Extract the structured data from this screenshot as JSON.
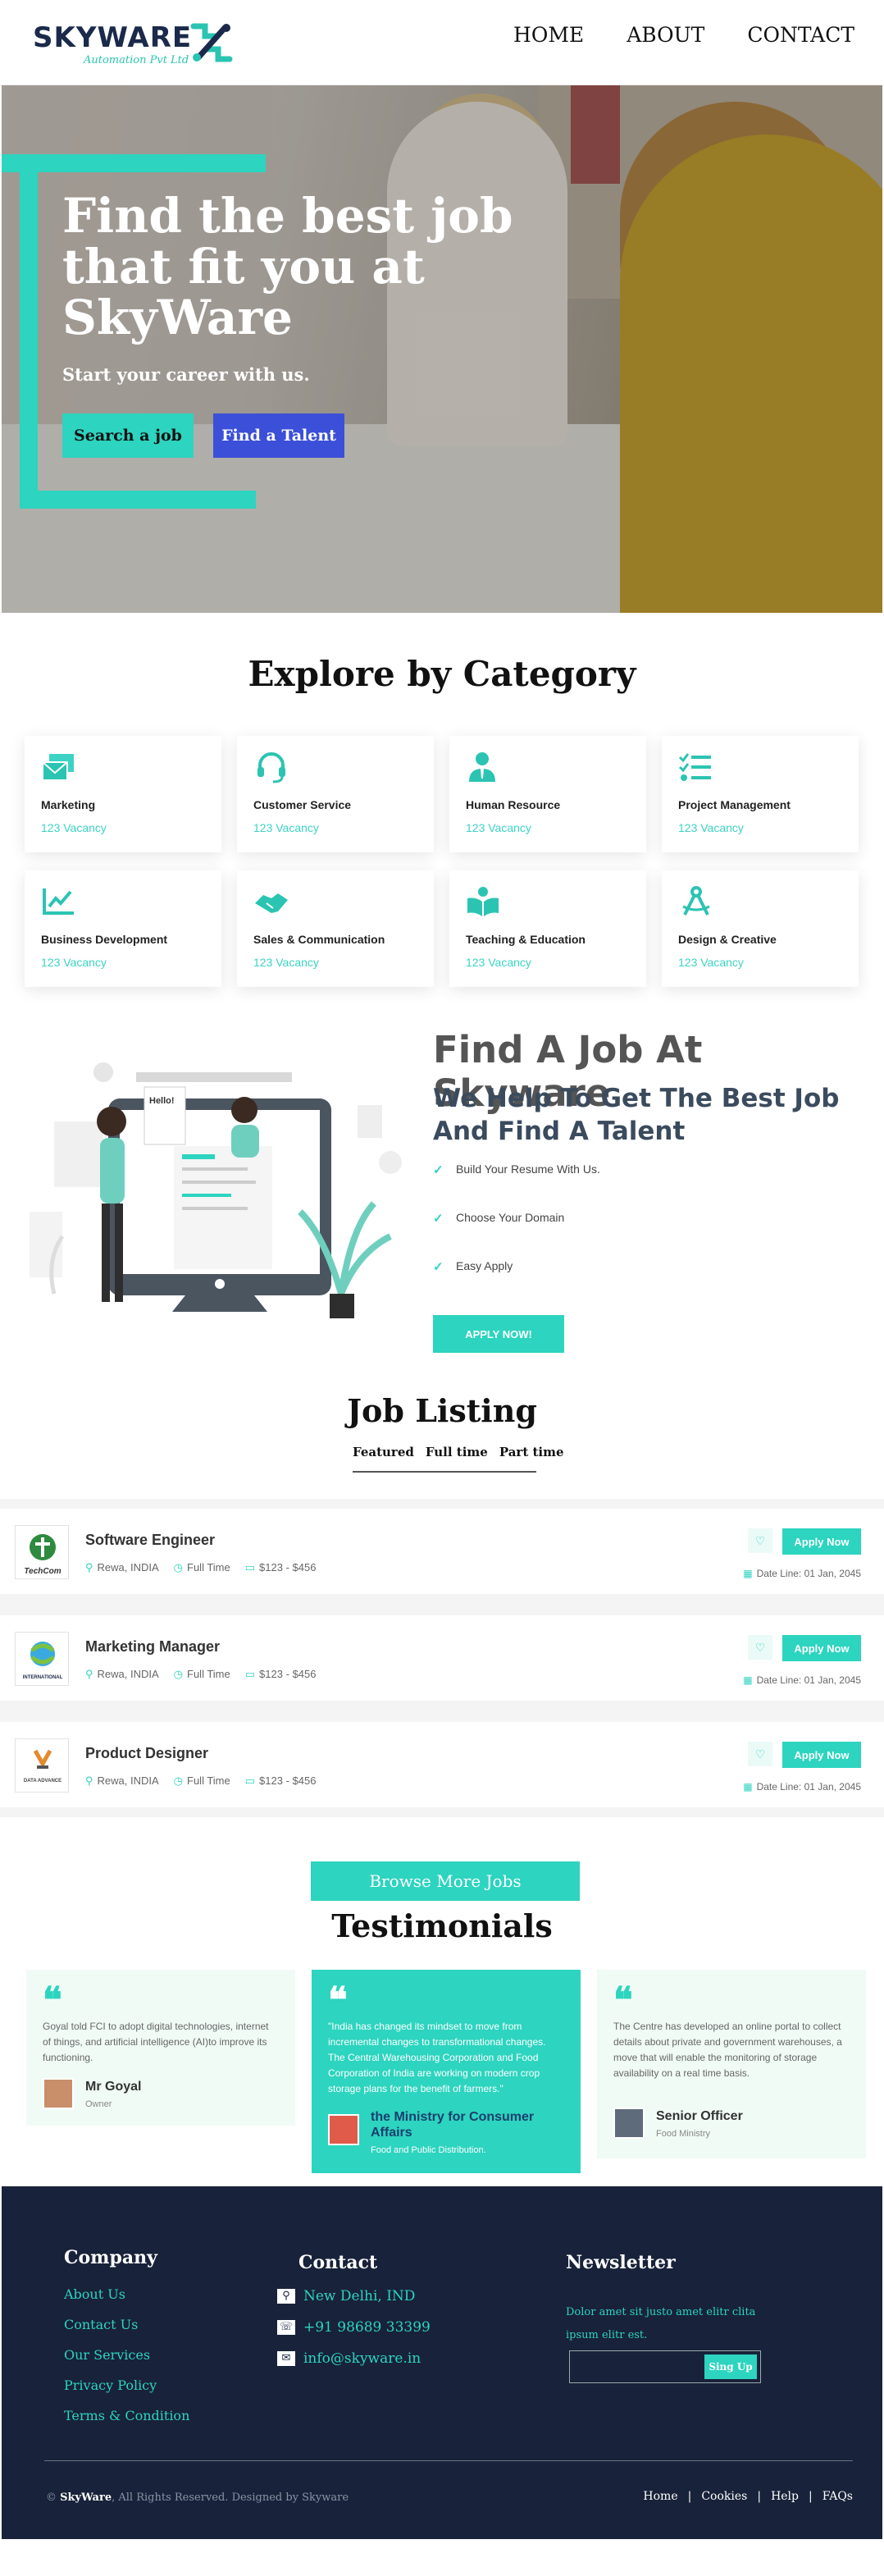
{
  "nav": {
    "logo_word": "SKYWARE",
    "logo_sub": "Automation Pvt Ltd",
    "links": [
      "HOME",
      "ABOUT",
      "CONTACT"
    ]
  },
  "hero": {
    "title": "Find the best job that fit you at SkyWare",
    "subtitle": "Start your career with us.",
    "btn_search": "Search a job",
    "btn_talent": "Find a Talent"
  },
  "categories": {
    "title": "Explore by Category",
    "items": [
      {
        "name": "Marketing",
        "vacancy": "123 Vacancy",
        "icon": "mail-icon"
      },
      {
        "name": "Customer Service",
        "vacancy": "123 Vacancy",
        "icon": "headset-icon"
      },
      {
        "name": "Human Resource",
        "vacancy": "123 Vacancy",
        "icon": "user-tie-icon"
      },
      {
        "name": "Project Management",
        "vacancy": "123 Vacancy",
        "icon": "tasks-icon"
      },
      {
        "name": "Business Development",
        "vacancy": "123 Vacancy",
        "icon": "chart-line-icon"
      },
      {
        "name": "Sales & Communication",
        "vacancy": "123 Vacancy",
        "icon": "handshake-icon"
      },
      {
        "name": "Teaching & Education",
        "vacancy": "123 Vacancy",
        "icon": "book-reader-icon"
      },
      {
        "name": "Design & Creative",
        "vacancy": "123 Vacancy",
        "icon": "drafting-compass-icon"
      }
    ]
  },
  "find": {
    "title": "Find A Job At Skyware",
    "subtitle": "We Help To Get The Best Job And Find A Talent",
    "checks": [
      "Build Your Resume With Us.",
      "Choose Your Domain",
      "Easy Apply"
    ],
    "apply": "APPLY NOW!",
    "illus_greeting": "Hello!"
  },
  "jobs": {
    "title": "Job Listing",
    "tabs": [
      "Featured",
      "Full time",
      "Part time"
    ],
    "items": [
      {
        "title": "Software Engineer",
        "location": "Rewa, INDIA",
        "type": "Full Time",
        "salary": "$123 - $456",
        "date": "Date Line: 01 Jan, 2045",
        "apply": "Apply Now",
        "logo_text": "TechCom"
      },
      {
        "title": "Marketing Manager",
        "location": "Rewa, INDIA",
        "type": "Full Time",
        "salary": "$123 - $456",
        "date": "Date Line: 01 Jan, 2045",
        "apply": "Apply Now",
        "logo_text": "INTERNATIONAL"
      },
      {
        "title": "Product Designer",
        "location": "Rewa, INDIA",
        "type": "Full Time",
        "salary": "$123 - $456",
        "date": "Date Line: 01 Jan, 2045",
        "apply": "Apply Now",
        "logo_text": "DATA ADVANCE"
      }
    ],
    "browse": "Browse More Jobs"
  },
  "testimonials": {
    "title": "Testimonials",
    "items": [
      {
        "quote": "Goyal told FCI to adopt digital technologies, internet of things, and artificial intelligence (AI)to improve its functioning.",
        "name": "Mr Goyal",
        "role": "Owner"
      },
      {
        "quote": "\"India has changed its mindset to move from incremental changes to transformational changes. The Central Warehousing Corporation and Food Corporation of India are working on modern crop storage plans for the benefit of farmers.\"",
        "name": "the Ministry for Consumer Affairs",
        "role": "Food and Public Distribution."
      },
      {
        "quote": "The Centre has developed an online portal to collect details about private and government warehouses, a move that will enable the monitoring of storage availability on a real time basis.",
        "name": "Senior Officer",
        "role": "Food Ministry"
      }
    ]
  },
  "footer": {
    "company_title": "Company",
    "company_links": [
      "About Us",
      "Contact Us",
      "Our Services",
      "Privacy Policy",
      "Terms & Condition"
    ],
    "contact_title": "Contact",
    "contact": {
      "address": "New Delhi, IND",
      "phone": "+91 98689 33399",
      "email": "info@skyware.in"
    },
    "newsletter_title": "Newsletter",
    "newsletter_text": "Dolor amet sit justo amet elitr clita ipsum elitr est.",
    "signup": "Sing Up",
    "copyright_brand": "SkyWare",
    "copyright_rest": ", All Rights Reserved. Designed by Skyware",
    "copyright_symbol": "©",
    "bottom_links": [
      "Home",
      "Cookies",
      "Help",
      "FAQs"
    ]
  },
  "colors": {
    "accent": "#2dd4bf",
    "blue": "#3b4fd8",
    "navy": "#18223a",
    "brand": "#1b2a4a"
  }
}
